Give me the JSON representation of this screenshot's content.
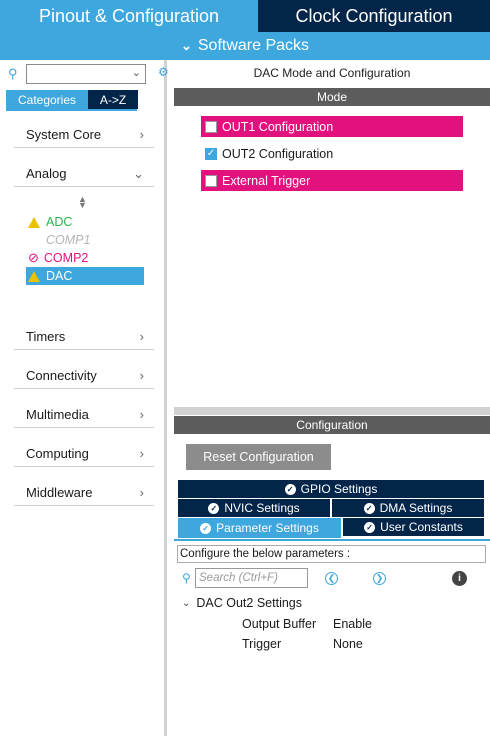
{
  "top_tabs": {
    "pinout": "Pinout & Configuration",
    "clock": "Clock Configuration"
  },
  "software_packs": {
    "label": "Software Packs",
    "icon": "chevron-down-icon"
  },
  "left": {
    "tabs": {
      "categories": "Categories",
      "az": "A->Z"
    },
    "categories": [
      {
        "label": "System Core",
        "arrow": ">"
      },
      {
        "label": "Analog",
        "arrow": "v"
      },
      {
        "label": "Timers",
        "arrow": ">"
      },
      {
        "label": "Connectivity",
        "arrow": ">"
      },
      {
        "label": "Multimedia",
        "arrow": ">"
      },
      {
        "label": "Computing",
        "arrow": ">"
      },
      {
        "label": "Middleware",
        "arrow": ">"
      }
    ],
    "analog_items": [
      {
        "label": "ADC",
        "status": "warning",
        "color": "#2db34a"
      },
      {
        "label": "COMP1",
        "status": "disabled",
        "color": "#b5b5b5"
      },
      {
        "label": "COMP2",
        "status": "error",
        "color": "#e2117d"
      },
      {
        "label": "DAC",
        "status": "warning",
        "color": "#ffffff",
        "selected": true
      }
    ]
  },
  "right": {
    "title": "DAC Mode and Configuration",
    "mode_header": "Mode",
    "mode_rows": [
      {
        "label": "OUT1 Configuration",
        "checked": false,
        "highlight": "#e2117d"
      },
      {
        "label": "OUT2 Configuration",
        "checked": true
      },
      {
        "label": "External Trigger",
        "checked": false,
        "highlight": "#e2117d"
      }
    ],
    "config_header": "Configuration",
    "reset_button": "Reset Configuration",
    "config_tabs": {
      "gpio": "GPIO Settings",
      "nvic": "NVIC Settings",
      "dma": "DMA Settings",
      "parameter": "Parameter Settings",
      "user_constants": "User Constants"
    },
    "params": {
      "hint": "Configure the below parameters :",
      "search_placeholder": "Search (Ctrl+F)",
      "group": "DAC Out2 Settings",
      "rows": [
        {
          "name": "Output Buffer",
          "value": "Enable"
        },
        {
          "name": "Trigger",
          "value": "None"
        }
      ]
    }
  },
  "colors": {
    "accent": "#3ea7de",
    "dark": "#04254a",
    "pink": "#e2117d",
    "header_gray": "#5c5c5c"
  }
}
